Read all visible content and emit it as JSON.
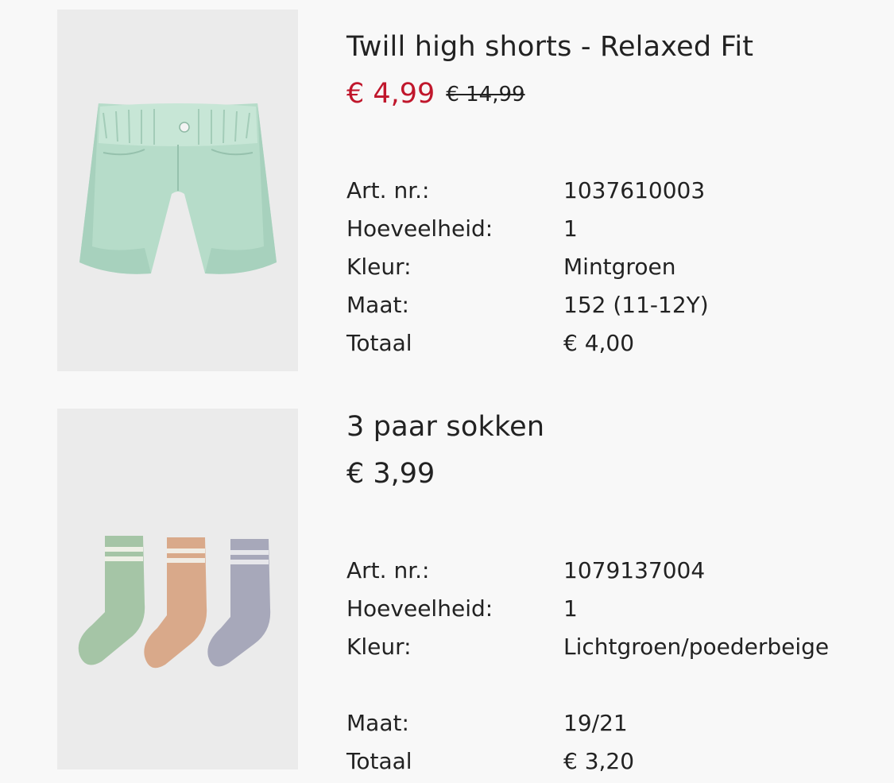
{
  "items": [
    {
      "title": "Twill high shorts - Relaxed Fit",
      "price": "€ 4,99",
      "old_price": "€ 14,99",
      "price_color": "#c0172c",
      "image_icon": "mint-shorts-image",
      "details": [
        {
          "label": "Art. nr.:",
          "value": "1037610003"
        },
        {
          "label": "Hoeveelheid:",
          "value": "1"
        },
        {
          "label": "Kleur:",
          "value": "Mintgroen"
        },
        {
          "label": "Maat:",
          "value": "152 (11-12Y)"
        },
        {
          "label": "Totaal",
          "value": "€ 4,00"
        }
      ]
    },
    {
      "title": "3 paar sokken",
      "price": "€ 3,99",
      "image_icon": "three-socks-image",
      "details": [
        {
          "label": "Art. nr.:",
          "value": "1079137004"
        },
        {
          "label": "Hoeveelheid:",
          "value": "1"
        },
        {
          "label": "Kleur:",
          "value": "Lichtgroen/poederbeige"
        },
        {
          "label": "Maat:",
          "value": "19/21"
        },
        {
          "label": "Totaal",
          "value": "€ 3,20"
        }
      ]
    }
  ]
}
